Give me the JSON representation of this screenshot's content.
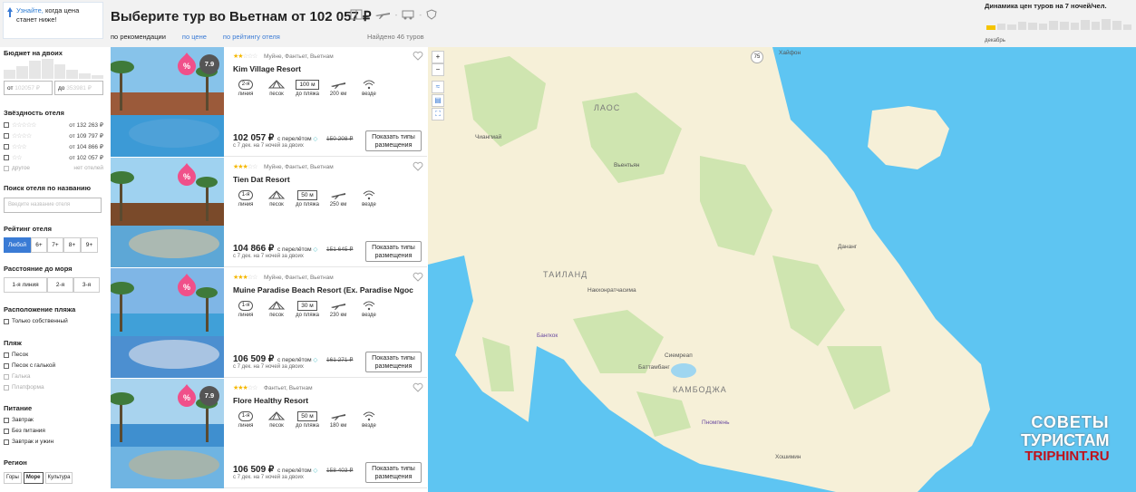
{
  "promo": {
    "link": "Узнайте,",
    "text": "когда цена станет ниже!"
  },
  "header": {
    "title": "Выберите тур во Вьетнам от 102 057 ₽",
    "sort_recommend": "по рекомендации",
    "sort_price": "по цене",
    "sort_rating": "по рейтингу отеля",
    "found": "Найдено 46 туров"
  },
  "dynamics": {
    "title": "Динамика цен туров на 7 ночей/чел.",
    "month": "декабрь"
  },
  "sidebar": {
    "budget_title": "Бюджет на двоих",
    "from_label": "от",
    "from_ph": "102057 ₽",
    "to_label": "до",
    "to_ph": "353981 ₽",
    "stars_title": "Звёздность отеля",
    "stars": [
      {
        "stars": "☆☆☆☆☆",
        "price": "от 132 263 ₽"
      },
      {
        "stars": "☆☆☆☆",
        "price": "от 109 797 ₽"
      },
      {
        "stars": "☆☆☆",
        "price": "от 104 866 ₽"
      },
      {
        "stars": "☆☆",
        "price": "от 102 057 ₽"
      },
      {
        "stars": "другое",
        "price": "нет отелей"
      }
    ],
    "search_title": "Поиск отеля по названию",
    "search_ph": "Введите название отеля",
    "rating_title": "Рейтинг отеля",
    "rating_opts": [
      "Любой",
      "6+",
      "7+",
      "8+",
      "9+"
    ],
    "sea_title": "Расстояние до моря",
    "sea_opts": [
      "1-я линия",
      "2-я",
      "3-я"
    ],
    "beach_loc_title": "Расположение пляжа",
    "beach_loc_opt": "Только собственный",
    "beach_title": "Пляж",
    "beach_opts": [
      "Песок",
      "Песок с галькой",
      "Галька",
      "Платформа"
    ],
    "food_title": "Питание",
    "food_opts": [
      "Завтрак",
      "Без питания",
      "Завтрак и ужин"
    ],
    "region_title": "Регион",
    "region_opts": [
      "Горы",
      "Море",
      "Культура"
    ]
  },
  "hotels": [
    {
      "stars": "★★",
      "empty": "☆☆☆",
      "loc": "Муйне, Фантьет, Вьетнам",
      "name": "Kim Village Resort",
      "line": "2-я",
      "line_lbl": "линия",
      "beach": "песок",
      "dist": "100 м",
      "dist_lbl": "до пляжа",
      "air": "200 км",
      "wifi": "везде",
      "price": "102 057 ₽",
      "with": "с перелётом",
      "old": "150 208 ₽",
      "dur": "с 7 дек. на 7 ночей за двоих",
      "btn": "Показать типы размещения",
      "rating": "7.9"
    },
    {
      "stars": "★★★",
      "empty": "☆☆",
      "loc": "Муйне, Фантьет, Вьетнам",
      "name": "Tien Dat Resort",
      "line": "1-я",
      "line_lbl": "линия",
      "beach": "песок",
      "dist": "50 м",
      "dist_lbl": "до пляжа",
      "air": "250 км",
      "wifi": "везде",
      "price": "104 866 ₽",
      "with": "с перелётом",
      "old": "151 645 ₽",
      "dur": "с 7 дек. на 7 ночей за двоих",
      "btn": "Показать типы размещения",
      "rating": ""
    },
    {
      "stars": "★★★",
      "empty": "☆☆",
      "loc": "Муйне, Фантьет, Вьетнам",
      "name": "Muine Paradise Beach Resort (Ex. Paradise Ngoc",
      "line": "1-я",
      "line_lbl": "линия",
      "beach": "песок",
      "dist": "30 м",
      "dist_lbl": "до пляжа",
      "air": "230 км",
      "wifi": "везде",
      "price": "106 509 ₽",
      "with": "с перелётом",
      "old": "161 271 ₽",
      "dur": "с 7 дек. на 7 ночей за двоих",
      "btn": "Показать типы размещения",
      "rating": ""
    },
    {
      "stars": "★★★",
      "empty": "☆☆",
      "loc": "Фантьет, Вьетнам",
      "name": "Flore Healthy Resort",
      "line": "1-я",
      "line_lbl": "линия",
      "beach": "песок",
      "dist": "50 м",
      "dist_lbl": "до пляжа",
      "air": "180 км",
      "wifi": "везде",
      "price": "106 509 ₽",
      "with": "с перелётом",
      "old": "158 403 ₽",
      "dur": "с 7 дек. на 7 ночей за двоих",
      "btn": "Показать типы размещения",
      "rating": "7.9"
    }
  ],
  "map": {
    "laos": "ЛАОС",
    "thailand": "ТАИЛАНД",
    "cambodia": "КАМБОДЖА",
    "cities": {
      "haiphong": "Хайфон",
      "chiangmai": "Чиангмай",
      "vientiane": "Вьентьян",
      "danang": "Дананг",
      "nakhon": "Накхонратчасима",
      "bangkok": "Бангкок",
      "siemreap": "Сиемреап",
      "battambang": "Баттамбанг",
      "phnompenh": "Пномпень",
      "hochiminh": "Хошимин"
    },
    "road": "75",
    "zoom_in": "+",
    "zoom_out": "−"
  },
  "watermark": {
    "line1": "СОВЕТЫ",
    "line2": "ТУРИСТАМ",
    "line3": "TRIPHINT.RU"
  },
  "colors": {
    "accent": "#3a7bd5",
    "sea": "#5ec5f2",
    "land": "#f6f0d8",
    "forest": "#cfe5b0",
    "star": "#f5b800",
    "discount": "#f0508a"
  }
}
